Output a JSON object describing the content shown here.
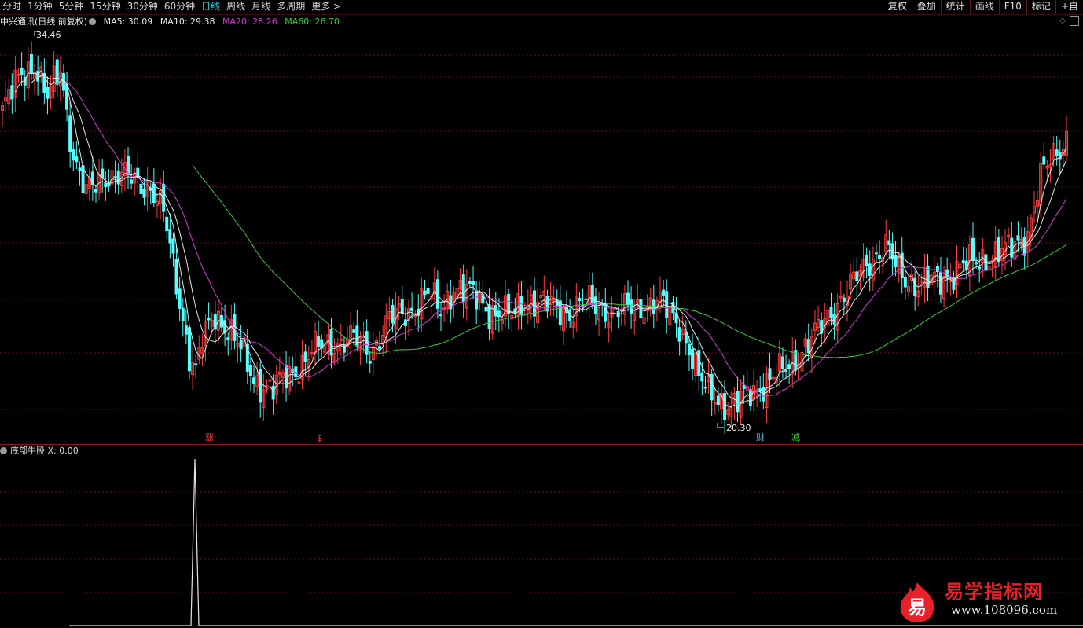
{
  "toolbar": {
    "period_tabs": [
      "分时",
      "1分钟",
      "5分钟",
      "15分钟",
      "30分钟",
      "60分钟",
      "日线",
      "周线",
      "月线",
      "多周期",
      "更多 >"
    ],
    "active_tab": "日线",
    "right_tools": [
      "复权",
      "叠加",
      "统计",
      "画线",
      "F10",
      "标记",
      "+自"
    ]
  },
  "legend": {
    "stock": "中兴通讯(日线 前复权)",
    "ma5": "MA5: 30.09",
    "ma10": "MA10: 29.38",
    "ma20": "MA20: 28.26",
    "ma60": "MA60: 26.70"
  },
  "chart_data": {
    "type": "candlestick",
    "price_range": [
      19.6,
      35.3
    ],
    "high_label": "34.46",
    "low_label": "20.30",
    "colors": {
      "up": "#ff3c3c",
      "down": "#54ffff",
      "ma5": "#e6e6e6",
      "ma10": "#e6e6e6",
      "ma20": "#d23ad2",
      "ma60": "#3cc83c"
    },
    "event_markers": [
      {
        "text": "涨",
        "color": "#ff3c3c"
      },
      {
        "text": "$",
        "color": "#ff3c3c"
      },
      {
        "text": "财",
        "color": "#54c8ff"
      },
      {
        "text": "减",
        "color": "#3cdc3c"
      }
    ]
  },
  "indicator": {
    "name": "底部牛股",
    "value": "X: 0.00"
  },
  "watermark": {
    "logo_char": "易",
    "title": "易学指标网",
    "url": "www.108096.com"
  }
}
